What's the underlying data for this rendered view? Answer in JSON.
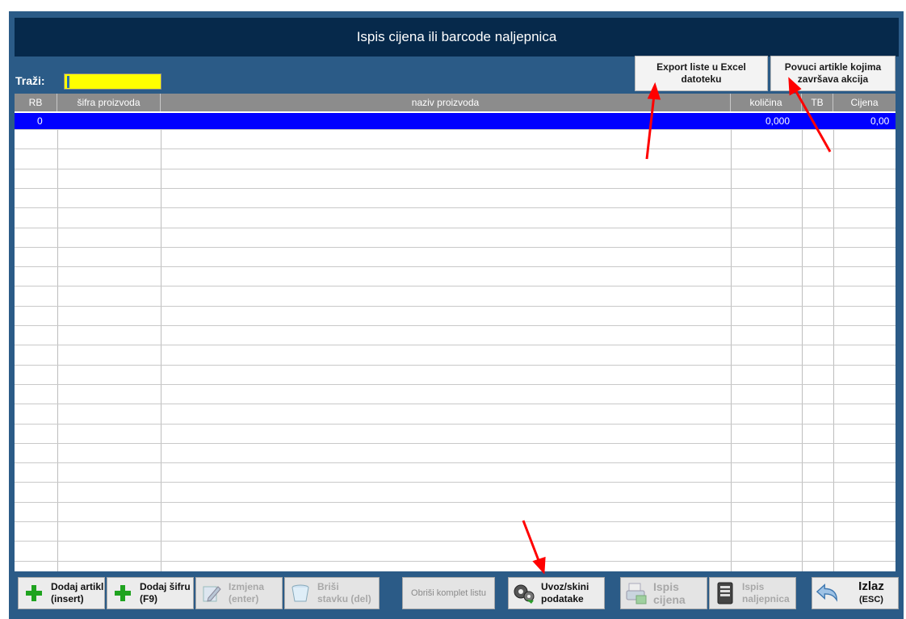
{
  "window": {
    "title": "Ispis cijena ili barcode naljepnica"
  },
  "search": {
    "label": "Traži:",
    "value": ""
  },
  "top_buttons": {
    "export": "Export liste u Excel datoteku",
    "pull": "Povuci artikle kojima završava akcija"
  },
  "grid": {
    "columns": [
      "RB",
      "šifra proizvoda",
      "naziv proizvoda",
      "količina",
      "TB",
      "Cijena"
    ],
    "rows": [
      {
        "rb": "0",
        "sifra": "",
        "naziv": "",
        "kolicina": "0,000",
        "tb": "",
        "cijena": "0,00"
      }
    ]
  },
  "toolbar": {
    "add_article": [
      "Dodaj artikl",
      "(insert)"
    ],
    "add_code": [
      "Dodaj šifru",
      "(F9)"
    ],
    "edit": [
      "Izmjena",
      "(enter)"
    ],
    "delete": [
      "Briši",
      "stavku (del)"
    ],
    "clear_list": "Obriši komplet listu",
    "import": [
      "Uvoz/skini",
      "podatake"
    ],
    "print_prices": [
      "Ispis",
      "cijena"
    ],
    "print_labels": [
      "Ispis",
      "naljepnica"
    ],
    "exit": [
      "Izlaz",
      "(ESC)"
    ]
  },
  "colors": {
    "accent": "#2b5b87",
    "titlebar": "#06294b",
    "selection": "#0000ff",
    "search_bg": "#ffff00",
    "annotation_arrow": "#ff0000"
  }
}
